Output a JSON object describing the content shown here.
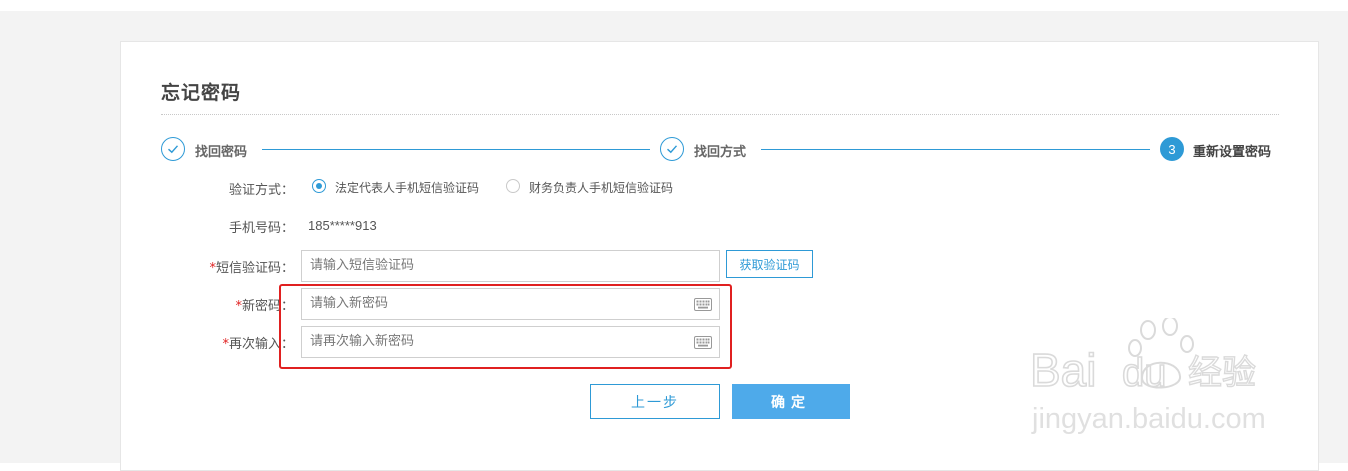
{
  "header": {
    "title": "忘记密码"
  },
  "steps": [
    {
      "label": "找回密码",
      "state": "done"
    },
    {
      "label": "找回方式",
      "state": "done"
    },
    {
      "label": "重新设置密码",
      "number": "3",
      "state": "active"
    }
  ],
  "form": {
    "verify_method_label": "验证方式：",
    "verify_options": [
      {
        "label": "法定代表人手机短信验证码",
        "checked": true
      },
      {
        "label": "财务负责人手机短信验证码",
        "checked": false
      }
    ],
    "phone_label": "手机号码：",
    "phone_value": "185*****913",
    "required_mark": "*",
    "sms_label": "短信验证码：",
    "sms_placeholder": "请输入短信验证码",
    "get_code_button": "获取验证码",
    "new_password_label": "新密码：",
    "new_password_placeholder": "请输入新密码",
    "confirm_label": "再次输入：",
    "confirm_placeholder": "请再次输入新密码"
  },
  "actions": {
    "prev": "上一步",
    "confirm": "确定"
  },
  "watermark": {
    "brand": "Baidu经验",
    "domain": "jingyan.baidu.com"
  },
  "colors": {
    "accent": "#2e9ad6",
    "primary_button": "#4eaaea",
    "highlight": "#e02020"
  }
}
